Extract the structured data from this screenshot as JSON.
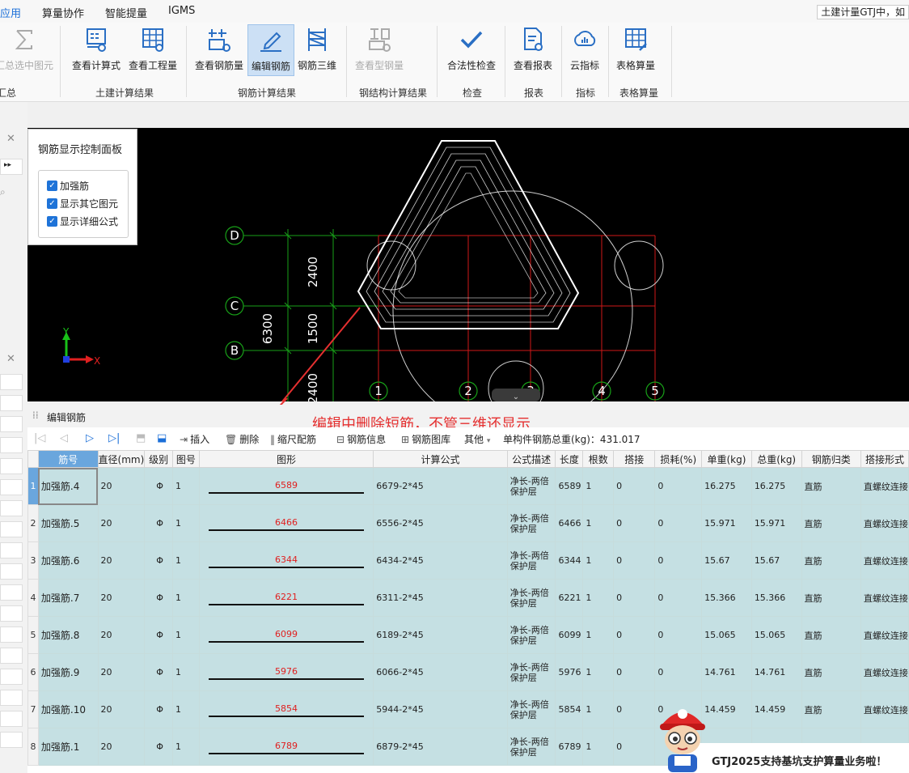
{
  "menu": {
    "items": [
      "应用",
      "算量协作",
      "智能提量",
      "IGMS"
    ],
    "active_index": 0,
    "window_title": "土建计量GTJ中，如"
  },
  "ribbon": {
    "buttons": [
      {
        "label": "汇总选中图元",
        "icon": "sum-icon",
        "disabled": true
      },
      {
        "label": "查看计算式",
        "icon": "formula-view-icon",
        "disabled": false
      },
      {
        "label": "查看工程量",
        "icon": "quantity-view-icon",
        "disabled": false
      },
      {
        "label": "查看钢筋量",
        "icon": "rebar-view-icon",
        "disabled": false
      },
      {
        "label": "编辑钢筋",
        "icon": "edit-rebar-icon",
        "disabled": false,
        "active": true
      },
      {
        "label": "钢筋三维",
        "icon": "rebar-3d-icon",
        "disabled": false
      },
      {
        "label": "查看型钢量",
        "icon": "steel-view-icon",
        "disabled": true
      },
      {
        "label": "合法性检查",
        "icon": "check-icon",
        "disabled": false
      },
      {
        "label": "查看报表",
        "icon": "report-icon",
        "disabled": false
      },
      {
        "label": "云指标",
        "icon": "cloud-icon",
        "disabled": false
      },
      {
        "label": "表格算量",
        "icon": "table-calc-icon",
        "disabled": false
      }
    ],
    "groups": [
      "汇总",
      "土建计算结果",
      "钢筋计算结果",
      "钢结构计算结果",
      "检查",
      "报表",
      "指标",
      "表格算量"
    ]
  },
  "control_panel": {
    "title": "钢筋显示控制面板",
    "options": [
      {
        "label": "加强筋",
        "checked": true
      },
      {
        "label": "显示其它图元",
        "checked": true
      },
      {
        "label": "显示详细公式",
        "checked": true
      }
    ]
  },
  "cad": {
    "axis_rows": [
      "D",
      "C",
      "B"
    ],
    "axis_cols": [
      "1",
      "2",
      "3",
      "4",
      "5"
    ],
    "dims": [
      "2400",
      "1500",
      "6300",
      "2400"
    ],
    "axis_y": "Y",
    "axis_x": "X"
  },
  "edit_panel": {
    "title": "编辑钢筋",
    "annotation": "编辑中删除短筋，不管三维还显示",
    "toolbar": {
      "insert": "插入",
      "delete": "删除",
      "scale_config": "缩尺配筋",
      "rebar_info": "钢筋信息",
      "rebar_library": "钢筋图库",
      "other": "其他",
      "total_weight": "单构件钢筋总重(kg)：431.017"
    },
    "columns": [
      "筋号",
      "直径(mm)",
      "级别",
      "图号",
      "图形",
      "计算公式",
      "公式描述",
      "长度",
      "根数",
      "搭接",
      "损耗(%)",
      "单重(kg)",
      "总重(kg)",
      "钢筋归类",
      "搭接形式"
    ],
    "rows": [
      {
        "no": "1",
        "name": "加强筋.4",
        "dia": "20",
        "grade": "Φ",
        "fig": "1",
        "shape": "6589",
        "formula": "6679-2*45",
        "desc": "净长-两倍保护层",
        "len": "6589",
        "count": "1",
        "lap": "0",
        "loss": "0",
        "unit": "16.275",
        "total": "16.275",
        "cat": "直筋",
        "lap_type": "直螺纹连接"
      },
      {
        "no": "2",
        "name": "加强筋.5",
        "dia": "20",
        "grade": "Φ",
        "fig": "1",
        "shape": "6466",
        "formula": "6556-2*45",
        "desc": "净长-两倍保护层",
        "len": "6466",
        "count": "1",
        "lap": "0",
        "loss": "0",
        "unit": "15.971",
        "total": "15.971",
        "cat": "直筋",
        "lap_type": "直螺纹连接"
      },
      {
        "no": "3",
        "name": "加强筋.6",
        "dia": "20",
        "grade": "Φ",
        "fig": "1",
        "shape": "6344",
        "formula": "6434-2*45",
        "desc": "净长-两倍保护层",
        "len": "6344",
        "count": "1",
        "lap": "0",
        "loss": "0",
        "unit": "15.67",
        "total": "15.67",
        "cat": "直筋",
        "lap_type": "直螺纹连接"
      },
      {
        "no": "4",
        "name": "加强筋.7",
        "dia": "20",
        "grade": "Φ",
        "fig": "1",
        "shape": "6221",
        "formula": "6311-2*45",
        "desc": "净长-两倍保护层",
        "len": "6221",
        "count": "1",
        "lap": "0",
        "loss": "0",
        "unit": "15.366",
        "total": "15.366",
        "cat": "直筋",
        "lap_type": "直螺纹连接"
      },
      {
        "no": "5",
        "name": "加强筋.8",
        "dia": "20",
        "grade": "Φ",
        "fig": "1",
        "shape": "6099",
        "formula": "6189-2*45",
        "desc": "净长-两倍保护层",
        "len": "6099",
        "count": "1",
        "lap": "0",
        "loss": "0",
        "unit": "15.065",
        "total": "15.065",
        "cat": "直筋",
        "lap_type": "直螺纹连接"
      },
      {
        "no": "6",
        "name": "加强筋.9",
        "dia": "20",
        "grade": "Φ",
        "fig": "1",
        "shape": "5976",
        "formula": "6066-2*45",
        "desc": "净长-两倍保护层",
        "len": "5976",
        "count": "1",
        "lap": "0",
        "loss": "0",
        "unit": "14.761",
        "total": "14.761",
        "cat": "直筋",
        "lap_type": "直螺纹连接"
      },
      {
        "no": "7",
        "name": "加强筋.10",
        "dia": "20",
        "grade": "Φ",
        "fig": "1",
        "shape": "5854",
        "formula": "5944-2*45",
        "desc": "净长-两倍保护层",
        "len": "5854",
        "count": "1",
        "lap": "0",
        "loss": "0",
        "unit": "14.459",
        "total": "14.459",
        "cat": "直筋",
        "lap_type": "直螺纹连接"
      },
      {
        "no": "8",
        "name": "加强筋.1",
        "dia": "20",
        "grade": "Φ",
        "fig": "1",
        "shape": "6789",
        "formula": "6879-2*45",
        "desc": "净长-两倍保护层",
        "len": "6789",
        "count": "1",
        "lap": "0",
        "loss": "",
        "unit": "",
        "total": "",
        "cat": "",
        "lap_type": ""
      }
    ]
  },
  "promo": {
    "text": "GTJ2025支持基坑支护算量业务啦！"
  },
  "colors": {
    "accent": "#1b6fd8",
    "row_bg": "#c5e0e3",
    "header_highlight": "#6aa6dd",
    "annotation": "#e53030",
    "cad_bg": "#000000",
    "grid_red": "#d01818",
    "grid_green": "#18a018"
  }
}
